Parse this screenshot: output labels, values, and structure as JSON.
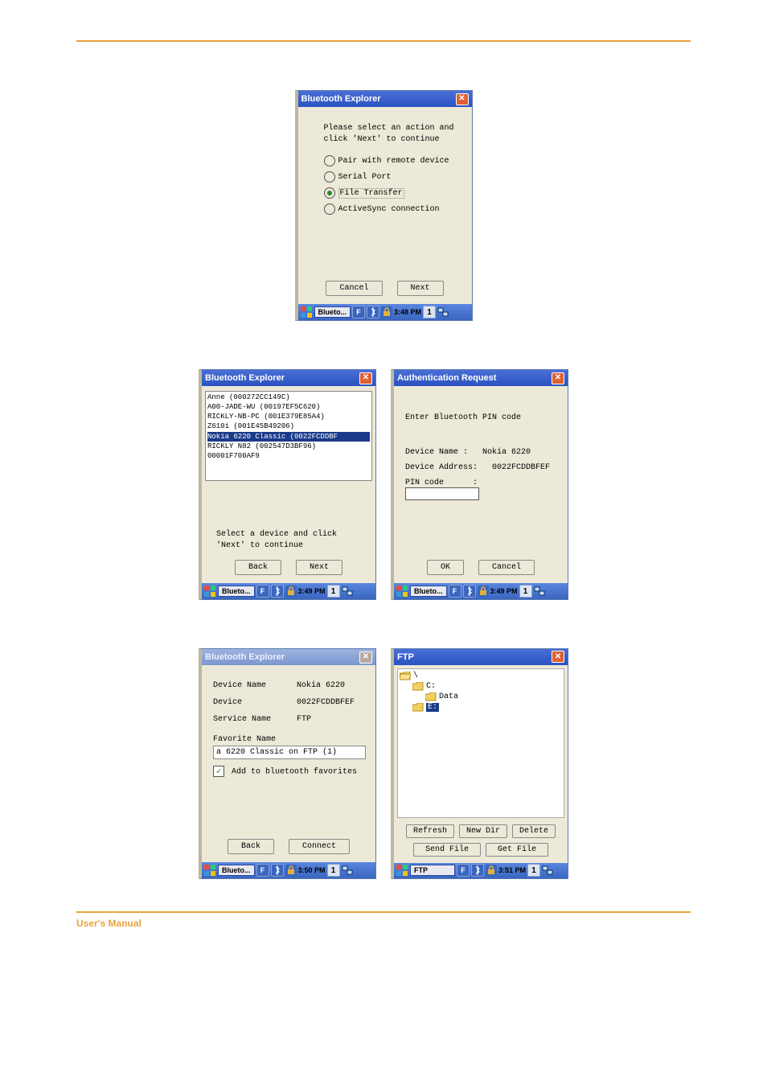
{
  "footer_label": "User's Manual",
  "win1": {
    "title": "Bluetooth Explorer",
    "instruction": "Please select an action and click 'Next'  to continue",
    "options": [
      {
        "label": "Pair with remote device",
        "selected": false
      },
      {
        "label": "Serial Port",
        "selected": false
      },
      {
        "label": "File Transfer",
        "selected": true
      },
      {
        "label": "ActiveSync connection",
        "selected": false
      }
    ],
    "btn_cancel": "Cancel",
    "btn_next": "Next",
    "taskbar": {
      "app": "Blueto...",
      "time": "3:48 PM",
      "ind": "1"
    }
  },
  "win2": {
    "title": "Bluetooth Explorer",
    "devices": [
      "Anne (000272CC149C)",
      "A00-JADE-WU (00197EF5C620)",
      "RICKLY-NB-PC (001E379E85A4)",
      "Z610i (001E45B49206)",
      "Nokia 6220 Classic (0022FCDDBF",
      "RICKLY N82 (002547D3BF96)",
      "00001F700AF9"
    ],
    "selected_index": 4,
    "instruction": "Select a device and click 'Next' to continue",
    "btn_back": "Back",
    "btn_next": "Next",
    "taskbar": {
      "app": "Blueto...",
      "time": "3:49 PM",
      "ind": "1"
    }
  },
  "win3": {
    "title": "Authentication Request",
    "instruction": "Enter Bluetooth PIN code",
    "name_label": "Device Name   :",
    "name_value": "Nokia 6220",
    "addr_label": "Device Address:",
    "addr_value": "0022FCDDBFEF",
    "pin_label": "PIN code      :",
    "btn_ok": "OK",
    "btn_cancel": "Cancel",
    "taskbar": {
      "app": "Blueto...",
      "time": "3:49 PM",
      "ind": "1"
    }
  },
  "win4": {
    "title": "Bluetooth Explorer",
    "name_label": "Device Name",
    "name_value": "Nokia 6220",
    "dev_label": "Device",
    "dev_value": "0022FCDDBFEF",
    "svc_label": "Service Name",
    "svc_value": "FTP",
    "fav_label": "Favorite Name",
    "fav_value": "a 6220 Classic on FTP (1)",
    "check_label": "Add to bluetooth favorites",
    "btn_back": "Back",
    "btn_connect": "Connect",
    "taskbar": {
      "app": "Blueto...",
      "time": "3:50 PM",
      "ind": "1"
    }
  },
  "win5": {
    "title": "FTP",
    "tree": [
      {
        "indent": 0,
        "label": "\\",
        "open": true,
        "sel": false
      },
      {
        "indent": 1,
        "label": "C:",
        "open": false,
        "sel": false
      },
      {
        "indent": 2,
        "label": "Data",
        "open": false,
        "sel": false
      },
      {
        "indent": 1,
        "label": "E:",
        "open": false,
        "sel": true
      }
    ],
    "btn_refresh": "Refresh",
    "btn_newdir": "New Dir",
    "btn_delete": "Delete",
    "btn_send": "Send File",
    "btn_get": "Get File",
    "taskbar": {
      "app": "FTP",
      "time": "3:51 PM",
      "ind": "1"
    }
  }
}
